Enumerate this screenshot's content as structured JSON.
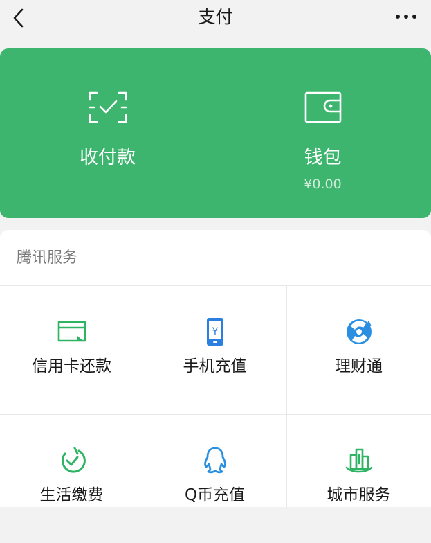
{
  "nav": {
    "title": "支付",
    "back_icon": "chevron-left-icon",
    "more_icon": "more-dots-icon"
  },
  "card": {
    "color": "#3db56e",
    "items": [
      {
        "label": "收付款",
        "icon": "scan-check-icon"
      },
      {
        "label": "钱包",
        "sub": "¥0.00",
        "icon": "wallet-icon"
      }
    ]
  },
  "services": {
    "title": "腾讯服务",
    "items": [
      {
        "label": "信用卡还款",
        "icon": "credit-card-icon",
        "color": "#2fb464"
      },
      {
        "label": "手机充值",
        "icon": "mobile-yen-icon",
        "color": "#2a7fe0"
      },
      {
        "label": "理财通",
        "icon": "wealth-icon",
        "color": "#2a8fe0"
      },
      {
        "label": "生活缴费",
        "icon": "utility-check-icon",
        "color": "#2fb464"
      },
      {
        "label": "Q币充值",
        "icon": "qq-penguin-icon",
        "color": "#2a8fe0"
      },
      {
        "label": "城市服务",
        "icon": "city-buildings-icon",
        "color": "#2fb464"
      }
    ]
  }
}
